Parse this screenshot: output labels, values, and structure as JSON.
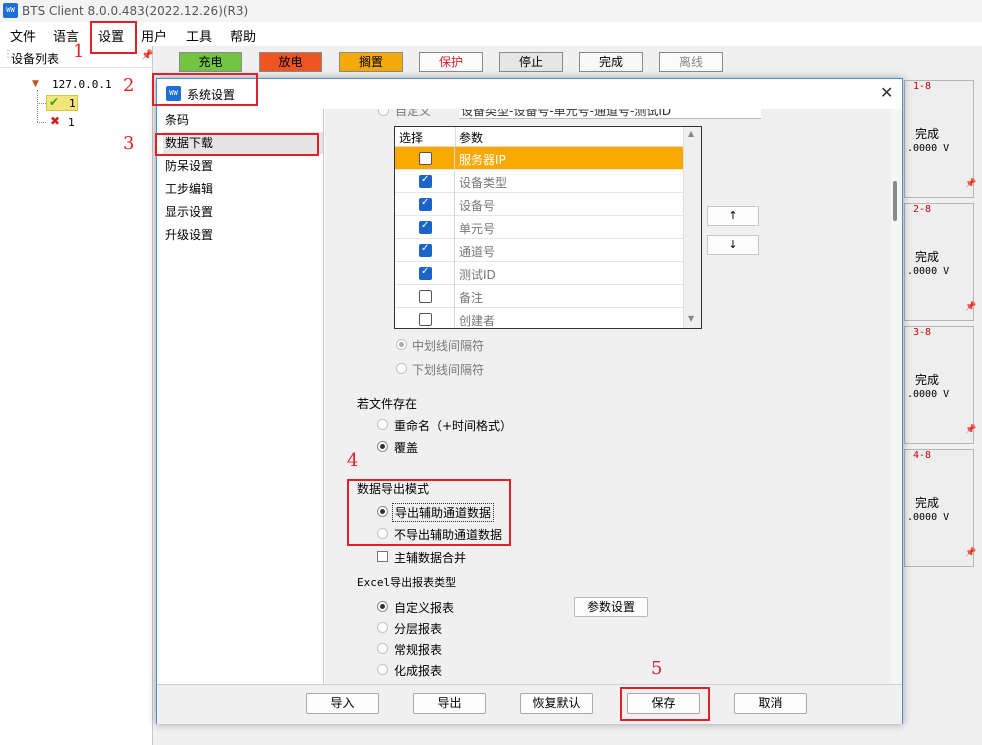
{
  "app": {
    "icon_text": "WW",
    "title": "BTS Client 8.0.0.483(2022.12.26)(R3)"
  },
  "menu": [
    "文件",
    "语言",
    "设置",
    "用户",
    "工具",
    "帮助"
  ],
  "device_panel": {
    "title": "设备列表",
    "root": "127.0.0.1",
    "children": [
      "1",
      "1"
    ]
  },
  "toolbar": {
    "buttons": [
      {
        "label": "充电",
        "color": "#72c442"
      },
      {
        "label": "放电",
        "color": "#ee5522"
      },
      {
        "label": "搁置",
        "color": "#f4a90c"
      },
      {
        "label": "保护",
        "color": "#fbfbfb",
        "text_color": "#e0202a"
      },
      {
        "label": "停止",
        "color": "#e6e6e6"
      },
      {
        "label": "完成",
        "color": "#f8f8f8"
      },
      {
        "label": "离线",
        "color": "#fbfbfb",
        "text_color": "#888888"
      }
    ]
  },
  "channels": [
    {
      "label": "1-8",
      "state": "完成",
      "volt": ".0000 V"
    },
    {
      "label": "2-8",
      "state": "完成",
      "volt": ".0000 V"
    },
    {
      "label": "3-8",
      "state": "完成",
      "volt": ".0000 V"
    },
    {
      "label": "4-8",
      "state": "完成",
      "volt": ".0000 V"
    }
  ],
  "dialog": {
    "title": "系统设置",
    "icon_text": "WW",
    "nav": [
      "条码",
      "数据下载",
      "防呆设置",
      "工步编辑",
      "显示设置",
      "升级设置"
    ],
    "custom_label": "自定义",
    "custom_value": "设备类型-设备号-单元号-通道号-测试ID",
    "table": {
      "headers": [
        "选择",
        "参数"
      ],
      "rows": [
        {
          "label": "服务器IP",
          "checked": false
        },
        {
          "label": "设备类型",
          "checked": true
        },
        {
          "label": "设备号",
          "checked": true
        },
        {
          "label": "单元号",
          "checked": true
        },
        {
          "label": "通道号",
          "checked": true
        },
        {
          "label": "测试ID",
          "checked": true
        },
        {
          "label": "备注",
          "checked": false
        },
        {
          "label": "创建者",
          "checked": false
        }
      ]
    },
    "move_up": "↑",
    "move_down": "↓",
    "separators": [
      "中划线间隔符",
      "下划线间隔符"
    ],
    "file_exists_title": "若文件存在",
    "file_exists_options": [
      "重命名（+时间格式）",
      "覆盖"
    ],
    "export_mode_title": "数据导出模式",
    "export_mode_options": [
      "导出辅助通道数据",
      "不导出辅助通道数据"
    ],
    "merge_label": "主辅数据合并",
    "report_type_title": "Excel导出报表类型",
    "report_options": [
      "自定义报表",
      "分层报表",
      "常规报表",
      "化成报表"
    ],
    "param_settings": "参数设置",
    "buttons": {
      "import": "导入",
      "export": "导出",
      "restore": "恢复默认",
      "save": "保存",
      "cancel": "取消"
    }
  },
  "annotations": [
    "1",
    "2",
    "3",
    "4",
    "5"
  ]
}
